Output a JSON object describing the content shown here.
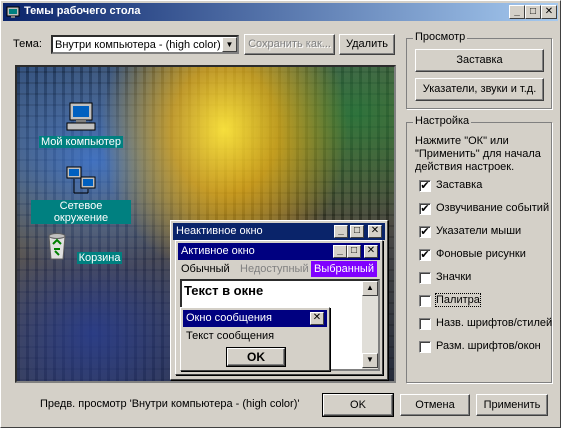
{
  "window": {
    "title": "Темы рабочего стола",
    "controls": {
      "minimize": "_",
      "maximize": "□",
      "close": "✕"
    }
  },
  "theme": {
    "label": "Тема:",
    "selected": "Внутри компьютера - (high color)",
    "save_label": "Сохранить как...",
    "delete_label": "Удалить"
  },
  "preview_group": {
    "legend": "Просмотр",
    "screensaver_button": "Заставка",
    "pointers_button": "Указатели, звуки и т.д."
  },
  "settings_group": {
    "legend": "Настройка",
    "hint_line1": "Нажмите \"ОК\" или",
    "hint_line2": "\"Применить\" для начала",
    "hint_line3": "действия настроек.",
    "items": [
      {
        "label": "Заставка",
        "checked": true,
        "mark": "✔"
      },
      {
        "label": "Озвучивание событий",
        "checked": true,
        "mark": "✔"
      },
      {
        "label": "Указатели мыши",
        "checked": true,
        "mark": "✔"
      },
      {
        "label": "Фоновые рисунки",
        "checked": true,
        "mark": "✔"
      },
      {
        "label": "Значки",
        "checked": false,
        "mark": ""
      },
      {
        "label": "Палитра",
        "checked": false,
        "mark": ""
      },
      {
        "label": "Назв. шрифтов/стилей",
        "checked": false,
        "mark": ""
      },
      {
        "label": "Разм. шрифтов/окон",
        "checked": false,
        "mark": ""
      }
    ]
  },
  "desktop": {
    "icons": [
      {
        "label": "Мой компьютер",
        "icon": "computer-icon"
      },
      {
        "label": "Сетевое окружение",
        "icon": "network-icon"
      },
      {
        "label": "Корзина",
        "icon": "recycle-bin-icon"
      }
    ],
    "inactive_window": {
      "title": "Неактивное окно",
      "title_color": "#0a246a"
    },
    "active_window": {
      "title": "Активное окно",
      "title_color": "#000080",
      "menu_normal": "Обычный",
      "menu_disabled": "Недоступный",
      "menu_selected": "Выбранный",
      "selected_color": "#8000ff",
      "window_text": "Текст в окне"
    },
    "message_box": {
      "title": "Окно сообщения",
      "text": "Текст сообщения",
      "ok_label": "OK"
    }
  },
  "footer": {
    "status": "Предв. просмотр 'Внутри компьютера - (high color)'",
    "ok_label": "OK",
    "cancel_label": "Отмена",
    "apply_label": "Применить"
  }
}
